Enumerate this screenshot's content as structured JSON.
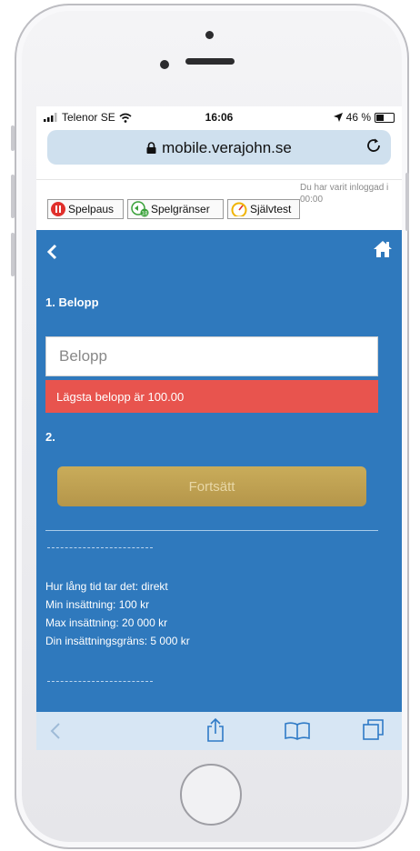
{
  "status_bar": {
    "carrier": "Telenor SE",
    "time": "16:06",
    "battery": "46 %"
  },
  "browser": {
    "url": "mobile.verajohn.se"
  },
  "responsible_gaming": {
    "buttons": [
      {
        "label": "Spelpaus",
        "icon": "pause-icon"
      },
      {
        "label": "Spelgränser",
        "icon": "limit-icon"
      },
      {
        "label": "Självtest",
        "icon": "gauge-icon"
      }
    ],
    "login_note": "Du har varit inloggad i 00:00"
  },
  "form": {
    "step1_label": "1. Belopp",
    "amount_placeholder": "Belopp",
    "error_message": "Lägsta belopp är 100.00",
    "step2_label": "2.",
    "continue_label": "Fortsätt"
  },
  "info": {
    "time_line": "Hur lång tid tar det: direkt",
    "min_line": "Min insättning: 100 kr",
    "max_line": "Max insättning: 20 000 kr",
    "limit_line": "Din insättningsgräns: 5 000 kr"
  },
  "colors": {
    "primary_blue": "#2f79bd",
    "error_red": "#e8544e",
    "gold_button": "#c4a653"
  }
}
